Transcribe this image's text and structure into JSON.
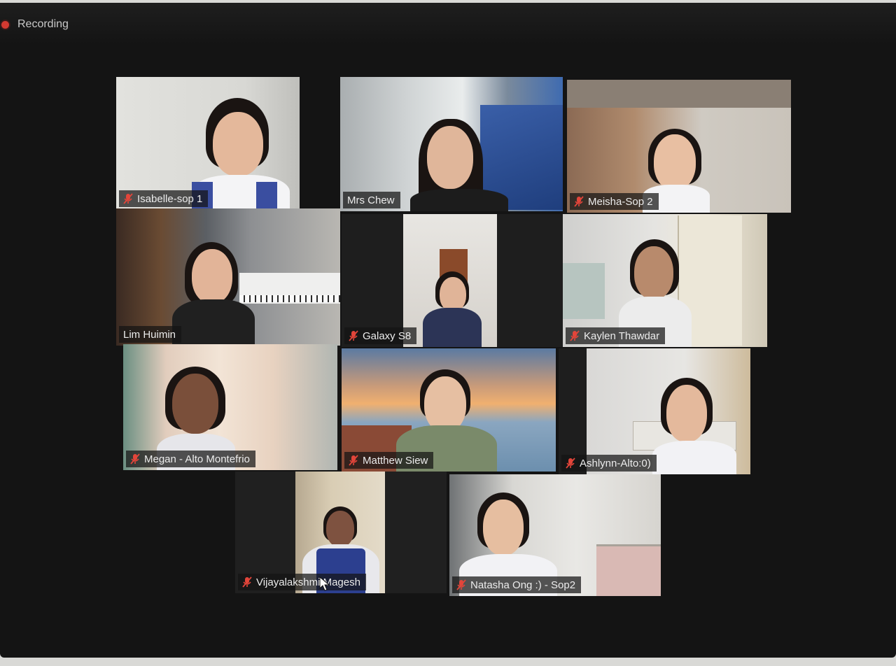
{
  "recording": {
    "label": "Recording"
  },
  "participants": [
    {
      "name": "Isabelle-sop 1"
    },
    {
      "name": "Mrs Chew"
    },
    {
      "name": "Meisha-Sop 2"
    },
    {
      "name": "Lim Huimin"
    },
    {
      "name": "Galaxy S8"
    },
    {
      "name": "Kaylen Thawdar"
    },
    {
      "name": "Megan - Alto Montefrio"
    },
    {
      "name": "Matthew Siew"
    },
    {
      "name": "Ashlynn-Alto:0)"
    },
    {
      "name": "Vijayalakshmi Magesh"
    },
    {
      "name": "Natasha Ong :) - Sop2"
    }
  ],
  "active_speaker": "Lim Huimin",
  "icons": {
    "muted": "mic-muted-icon",
    "cursor": "mouse-cursor-icon"
  },
  "colors": {
    "active_border": "#b9da3a",
    "muted_icon": "#e2453a",
    "recording_dot": "#d33a31"
  }
}
